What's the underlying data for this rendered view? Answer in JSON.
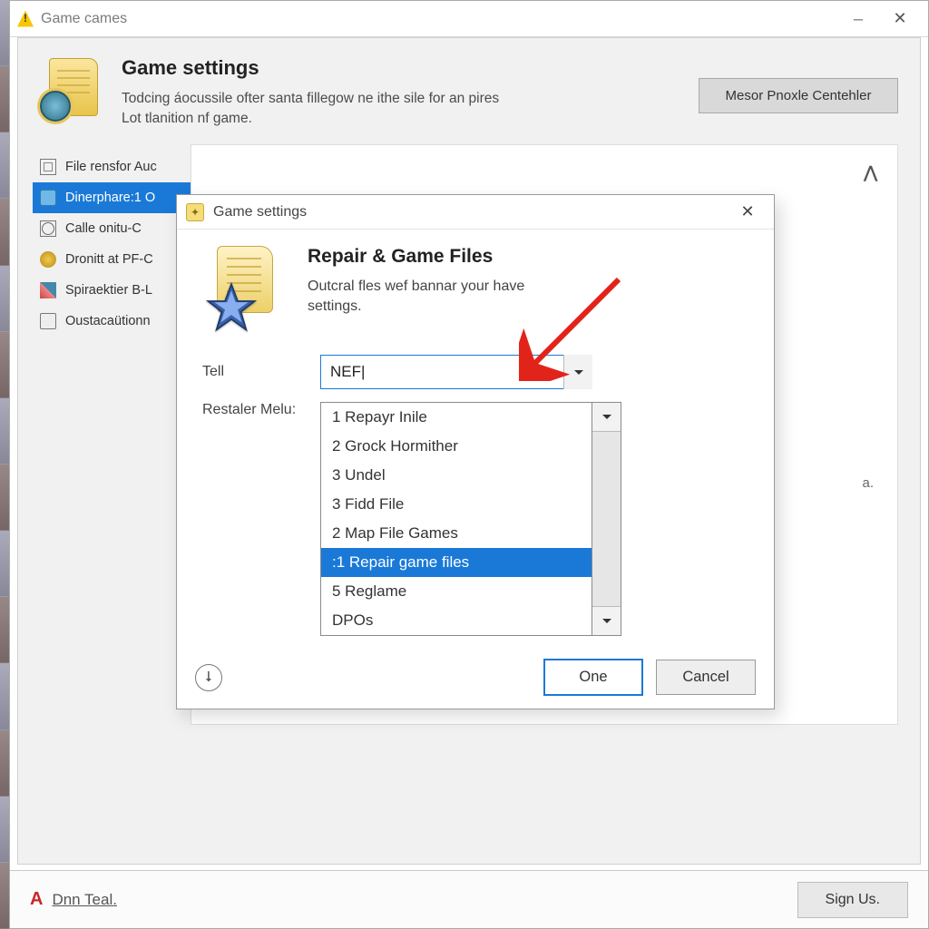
{
  "window": {
    "title": "Game cames",
    "header": {
      "title": "Game settings",
      "description": "Todcing áocussile ofter santa fillegow ne ithe sile for an pires Lot tlanition nf game.",
      "button": "Mesor Pnoxle Centehler"
    },
    "sidebar": {
      "items": [
        {
          "label": "File rensfor Auc",
          "icon": "file"
        },
        {
          "label": "Dinerphare:1 O",
          "icon": "cam",
          "selected": true
        },
        {
          "label": "Calle onitu-C",
          "icon": "net"
        },
        {
          "label": "Dronitt at PF-C",
          "icon": "dot"
        },
        {
          "label": "Spiraektier B-L",
          "icon": "tile"
        },
        {
          "label": "Oustacaütionn",
          "icon": "disk"
        }
      ]
    },
    "main": {
      "hint": "a.",
      "caret": "⋀"
    },
    "status": {
      "logo": "A",
      "text": "Dnn Teal.",
      "button": "Sign Us."
    }
  },
  "dialog": {
    "title": "Game settings",
    "heading": "Repair & Game Files",
    "subtext": "Outcral fles wef bannar your have settings.",
    "form": {
      "tell": {
        "label": "Tell",
        "value": "NEF|"
      },
      "restaler": {
        "label": "Restaler Melu:",
        "value": ""
      }
    },
    "options": [
      "1 Repayr Inile",
      "2 Grock Hormither",
      "3 Undel",
      "3 Fidd File",
      "2 Map File Games",
      ":1 Repair game files",
      "5 Reglame",
      "DPOs"
    ],
    "selected_option_index": 5,
    "buttons": {
      "ok": "One",
      "cancel": "Cancel"
    },
    "info_icon": "⭣"
  }
}
